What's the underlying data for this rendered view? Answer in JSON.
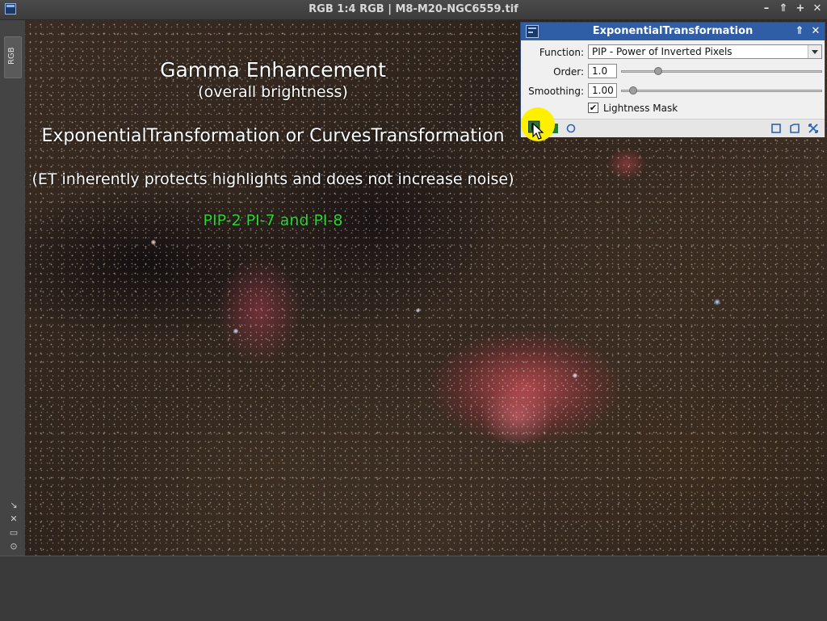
{
  "window": {
    "title": "RGB 1:4 RGB | M8-M20-NGC6559.tif",
    "controls": [
      "–",
      "⇑",
      "+",
      "✕"
    ]
  },
  "left_strip": {
    "tab_label": "RGB",
    "icons": [
      "↘",
      "✕",
      "▭",
      "⊙"
    ]
  },
  "overlay": {
    "line1": "Gamma Enhancement",
    "line2": "(overall brightness)",
    "line3": "ExponentialTransformation or CurvesTransformation",
    "line4": "(ET inherently protects highlights and does not increase noise)",
    "line5": "PIP-2 PI-7 and PI-8",
    "line5_color": "#2fd22f"
  },
  "dialog": {
    "title": "ExponentialTransformation",
    "function_label": "Function:",
    "function_value": "PIP - Power of Inverted Pixels",
    "order_label": "Order:",
    "order_value": "1.0",
    "order_slider_fraction": 0.17,
    "smoothing_label": "Smoothing:",
    "smoothing_value": "1.00",
    "smoothing_slider_fraction": 0.04,
    "lightness_mask_label": "Lightness Mask",
    "lightness_mask_checked": true,
    "titlebar_buttons": [
      "⇑",
      "✕"
    ]
  },
  "colors": {
    "dialog_title_bg": "#2f5ea6",
    "highlight": "#fff000"
  }
}
